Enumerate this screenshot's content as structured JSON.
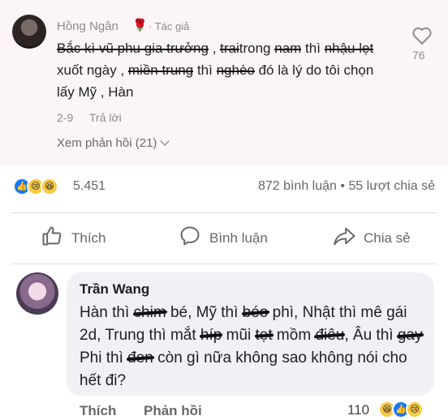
{
  "top_comment": {
    "author": "Hồng Ngân",
    "badge_icon": "rose-icon",
    "badge_label": "· Tác giả",
    "text": {
      "p1": "Bắc kì vũ phu gia trưởng",
      "p2": " , ",
      "p3": "trai",
      "p4": "trong ",
      "p5": "nam",
      "p6": " thì ",
      "p7": "nhậu lẹt",
      "p8": " xuốt ngày , ",
      "p9": "miền trung",
      "p10": " thì ",
      "p11": "nghèo",
      "p12": " đó là lý do tôi chọn lấy Mỹ , Hàn"
    },
    "time": "2-9",
    "reply_label": "Trả lời",
    "view_replies": "Xem phản hồi (21)",
    "like_count": "76"
  },
  "post_stats": {
    "reaction_icons": [
      "like-icon",
      "sad-icon",
      "haha-icon"
    ],
    "reaction_count": "5.451",
    "comments_shares": "872 bình luận • 55 lượt chia sẻ"
  },
  "actions": {
    "like": "Thích",
    "comment": "Bình luận",
    "share": "Chia sẻ"
  },
  "reply_comment": {
    "author": "Trần Wang",
    "text": {
      "t1": "Hàn thì ",
      "t2": "chim",
      "t3": " bé, Mỹ thì ",
      "t4": "béo",
      "t5": " phì, Nhật thì mê gái 2d, Trung thì mắt ",
      "t6": "híp",
      "t7": " mũi ",
      "t8": "tẹt",
      "t9": " mồm ",
      "t10": "điêu",
      "t11": ", Âu thì ",
      "t12": "gay",
      "t13": " Phi thì ",
      "t14": "đen",
      "t15": " còn gì nữa không sao không nói cho hết đi?"
    },
    "like_label": "Thích",
    "reply_label": "Phản hồi",
    "reaction_count": "110",
    "reaction_icons": [
      "haha-icon",
      "like-icon",
      "sad-icon"
    ]
  }
}
